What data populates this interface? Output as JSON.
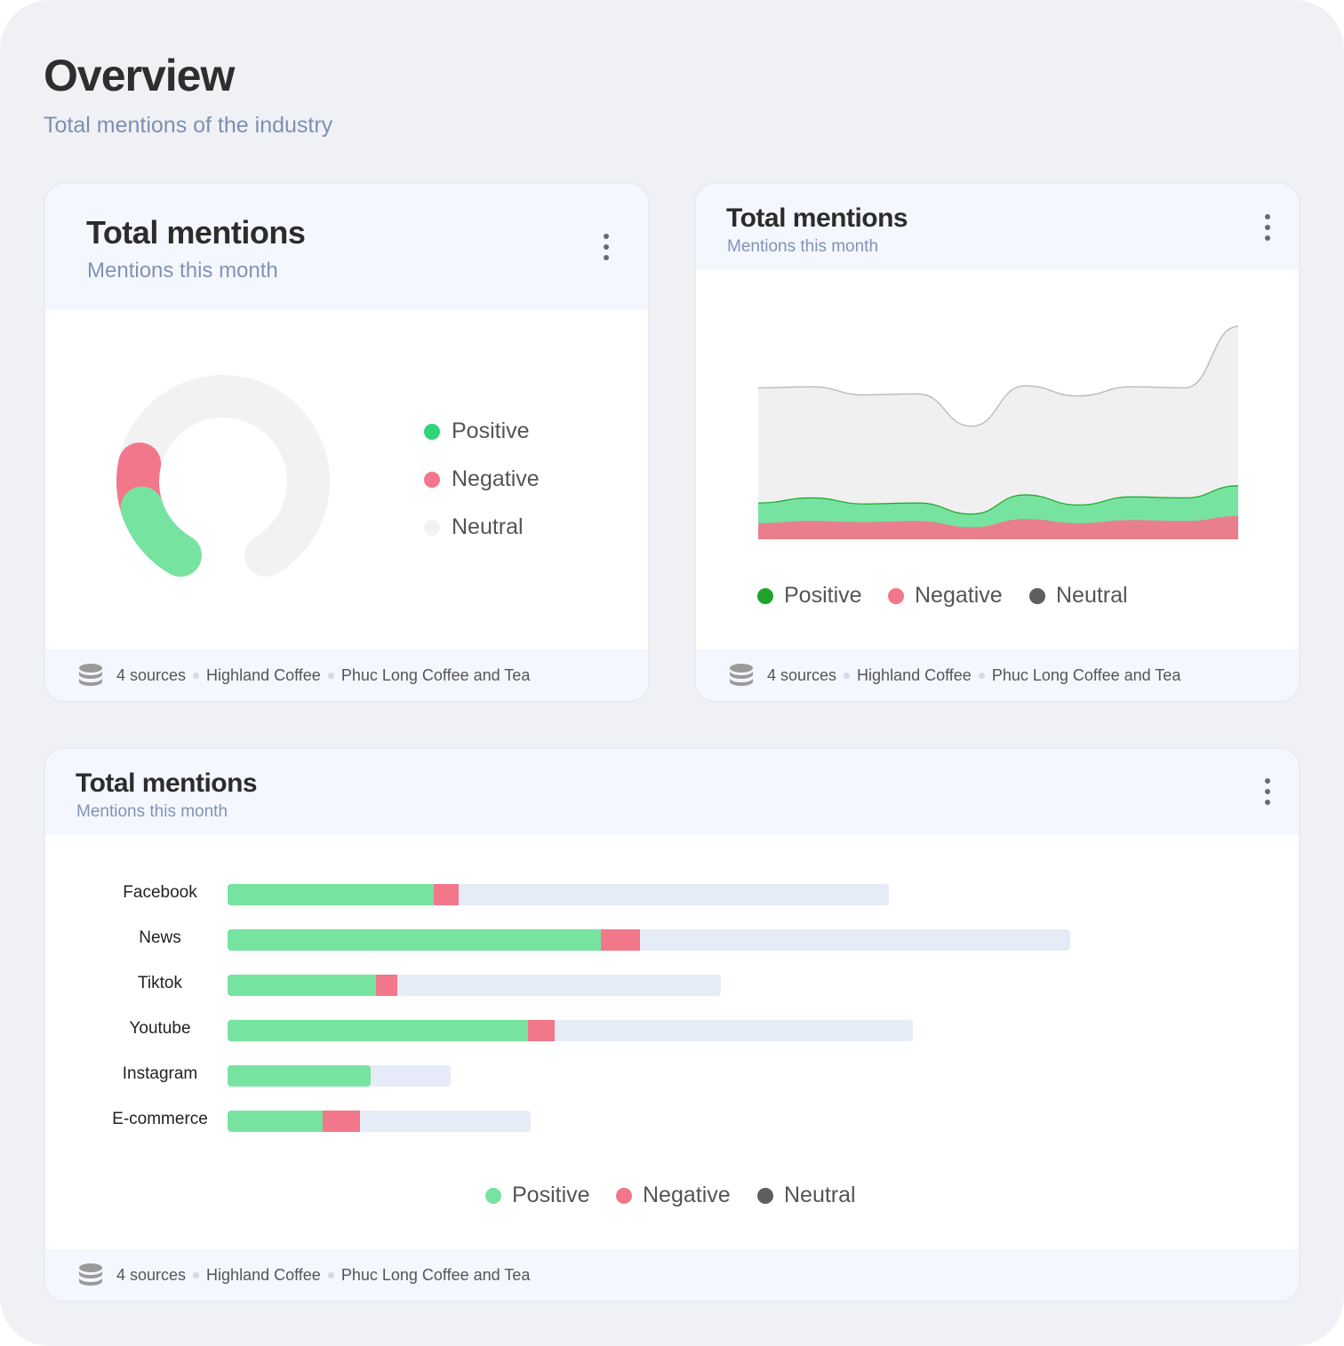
{
  "page": {
    "title": "Overview",
    "subtitle": "Total mentions of the industry"
  },
  "cards": {
    "donut": {
      "title": "Total mentions",
      "subtitle": "Mentions this month"
    },
    "area": {
      "title": "Total mentions",
      "subtitle": "Mentions this month"
    },
    "bars": {
      "title": "Total mentions",
      "subtitle": "Mentions this month"
    }
  },
  "footer": {
    "sources": "4 sources",
    "brand_1": "Highland Coffee",
    "brand_2": "Phuc Long Coffee and Tea"
  },
  "legend": {
    "positive": "Positive",
    "negative": "Negative",
    "neutral": "Neutral"
  },
  "colors": {
    "positive": "#2ed47a",
    "positive_soft": "#77e3a0",
    "positive_line": "#1ea42a",
    "negative": "#f2778a",
    "neutral": "#f2f2f2",
    "neutral_dark": "#5f5f5f",
    "track": "#e5ecf7"
  },
  "chart_data": [
    {
      "type": "pie",
      "variant": "semi-donut gauge",
      "labels": [
        "Positive",
        "Negative",
        "Neutral"
      ],
      "values": [
        14,
        8,
        78
      ]
    },
    {
      "type": "area",
      "stacked": true,
      "x": [
        1,
        2,
        3,
        4,
        5,
        6,
        7,
        8,
        9,
        10
      ],
      "series": [
        {
          "name": "Negative",
          "values": [
            16,
            18,
            17,
            18,
            12,
            20,
            16,
            19,
            18,
            23
          ]
        },
        {
          "name": "Positive",
          "values": [
            20,
            23,
            18,
            18,
            13,
            24,
            18,
            23,
            23,
            30
          ]
        },
        {
          "name": "Neutral",
          "values": [
            114,
            110,
            108,
            108,
            87,
            108,
            108,
            109,
            109,
            158
          ]
        }
      ],
      "ylim": [
        0,
        220
      ]
    },
    {
      "type": "bar",
      "orientation": "horizontal",
      "stacked": true,
      "categories": [
        "Facebook",
        "News",
        "Tiktok",
        "Youtube",
        "Instagram",
        "E-commerce"
      ],
      "series": [
        {
          "name": "Positive",
          "values": [
            232,
            420,
            167,
            338,
            161,
            107
          ]
        },
        {
          "name": "Negative",
          "values": [
            28,
            44,
            24,
            30,
            0,
            42
          ]
        },
        {
          "name": "Neutral",
          "values": [
            484,
            484,
            364,
            403,
            90,
            192
          ]
        }
      ],
      "xlim": [
        0,
        950
      ]
    }
  ]
}
